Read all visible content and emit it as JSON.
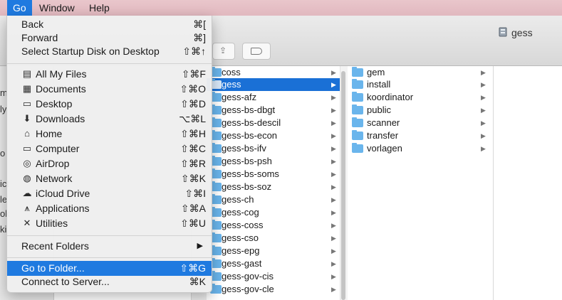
{
  "menubar": {
    "items": [
      "Go",
      "Window",
      "Help"
    ]
  },
  "window": {
    "title": "gess"
  },
  "sidebar_fragments": [
    "m",
    "ly",
    "o",
    "ict",
    "le",
    "ok",
    "ki"
  ],
  "columnB": {
    "items": [
      "coss",
      "gess",
      "gess-afz",
      "gess-bs-dbgt",
      "gess-bs-descil",
      "gess-bs-econ",
      "gess-bs-ifv",
      "gess-bs-psh",
      "gess-bs-soms",
      "gess-bs-soz",
      "gess-ch",
      "gess-cog",
      "gess-coss",
      "gess-cso",
      "gess-epg",
      "gess-gast",
      "gess-gov-cis",
      "gess-gov-cle"
    ],
    "selected": "gess"
  },
  "columnC": {
    "items": [
      "gem",
      "install",
      "koordinator",
      "public",
      "scanner",
      "transfer",
      "vorlagen"
    ]
  },
  "menu": {
    "back": {
      "label": "Back",
      "shortcut": "⌘["
    },
    "forward": {
      "label": "Forward",
      "shortcut": "⌘]"
    },
    "startup": {
      "label": "Select Startup Disk on Desktop",
      "shortcut": "⇧⌘↑"
    },
    "places": [
      {
        "label": "All My Files",
        "shortcut": "⇧⌘F",
        "icon": "all-files-icon",
        "glyph": "▤"
      },
      {
        "label": "Documents",
        "shortcut": "⇧⌘O",
        "icon": "documents-icon",
        "glyph": "▦"
      },
      {
        "label": "Desktop",
        "shortcut": "⇧⌘D",
        "icon": "desktop-icon",
        "glyph": "▭"
      },
      {
        "label": "Downloads",
        "shortcut": "⌥⌘L",
        "icon": "downloads-icon",
        "glyph": "⬇"
      },
      {
        "label": "Home",
        "shortcut": "⇧⌘H",
        "icon": "home-icon",
        "glyph": "⌂"
      },
      {
        "label": "Computer",
        "shortcut": "⇧⌘C",
        "icon": "computer-icon",
        "glyph": "▭"
      },
      {
        "label": "AirDrop",
        "shortcut": "⇧⌘R",
        "icon": "airdrop-icon",
        "glyph": "◎"
      },
      {
        "label": "Network",
        "shortcut": "⇧⌘K",
        "icon": "network-icon",
        "glyph": "◍"
      },
      {
        "label": "iCloud Drive",
        "shortcut": "⇧⌘I",
        "icon": "icloud-icon",
        "glyph": "☁"
      },
      {
        "label": "Applications",
        "shortcut": "⇧⌘A",
        "icon": "applications-icon",
        "glyph": "⩚"
      },
      {
        "label": "Utilities",
        "shortcut": "⇧⌘U",
        "icon": "utilities-icon",
        "glyph": "✕"
      }
    ],
    "recent": {
      "label": "Recent Folders",
      "arrow": "▶"
    },
    "goto": {
      "label": "Go to Folder...",
      "shortcut": "⇧⌘G"
    },
    "connect": {
      "label": "Connect to Server...",
      "shortcut": "⌘K"
    }
  }
}
